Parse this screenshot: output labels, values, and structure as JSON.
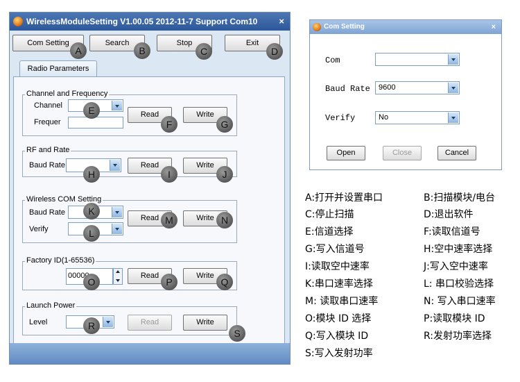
{
  "main_window": {
    "title": "WirelessModuleSetting V1.00.05 2012-11-7 Support Com10",
    "close_glyph": "×",
    "toolbar": {
      "com_setting": "Com Setting",
      "search": "Search",
      "stop": "Stop",
      "exit": "Exit"
    },
    "tab": "Radio Parameters",
    "channel_group": {
      "title": "Channel and Frequency",
      "channel_label": "Channel",
      "frequency_label": "Frequer",
      "read": "Read",
      "write": "Write"
    },
    "rf_group": {
      "title": "RF and Rate",
      "baud_label": "Baud Rate",
      "read": "Read",
      "write": "Write"
    },
    "com_group": {
      "title": "Wireless COM Setting",
      "baud_label": "Baud Rate",
      "verify_label": "Verify",
      "read": "Read",
      "write": "Write"
    },
    "factory_group": {
      "title": "Factory ID(1-65536)",
      "value": "00000",
      "read": "Read",
      "write": "Write"
    },
    "power_group": {
      "title": "Launch  Power",
      "level_label": "Level",
      "read": "Read",
      "write": "Write"
    }
  },
  "badges": [
    "A",
    "B",
    "C",
    "D",
    "E",
    "F",
    "G",
    "H",
    "I",
    "J",
    "K",
    "L",
    "M",
    "N",
    "O",
    "P",
    "Q",
    "R",
    "S"
  ],
  "com_dialog": {
    "title": "Com Setting",
    "close_glyph": "×",
    "com_label": "Com",
    "com_value": "",
    "baud_label": "Baud Rate",
    "baud_value": "9600",
    "verify_label": "Verify",
    "verify_value": "No",
    "open": "Open",
    "close": "Close",
    "cancel": "Cancel"
  },
  "legend": {
    "a": "A:打开并设置串口",
    "b": "B:扫描模块/电台",
    "c": "C:停止扫描",
    "d": "D:退出软件",
    "e": "E:信道选择",
    "f": "F:读取信道号",
    "g": "G:写入信道号",
    "h": "H:空中速率选择",
    "i": "I:读取空中速率",
    "j": "J:写入空中速率",
    "k": "K:串口速率选择",
    "l": "L:  串口校验选择",
    "m": "M:  读取串口速率",
    "n": "N:  写入串口速率",
    "o": "O:模块 ID 选择",
    "p": "P:读取模块 ID",
    "q": "Q:写入模块 ID",
    "r": "R:发射功率选择",
    "s": "S:写入发射功率"
  },
  "colors": {
    "titlebar": "#2c579a",
    "window_bg": "#dbe7f3",
    "badge": "#5a5a5a"
  }
}
